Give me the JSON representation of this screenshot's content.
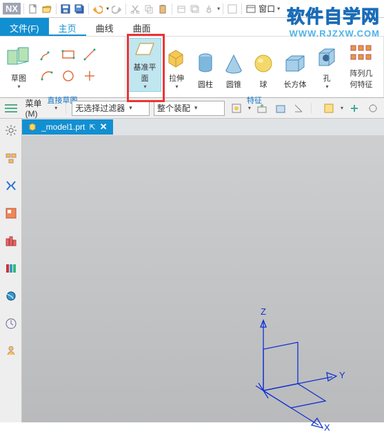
{
  "app": {
    "logo": "NX"
  },
  "qat": {
    "window_label": "窗口"
  },
  "tabs": {
    "file": "文件(F)",
    "home": "主页",
    "curve": "曲线",
    "surface": "曲面"
  },
  "ribbon": {
    "sketch_group_label": "直接草图",
    "sketch_big_label": "草图",
    "datum_plane": "基准平面",
    "extrude": "拉伸",
    "cylinder": "圆柱",
    "cone": "圆锥",
    "sphere": "球",
    "cuboid": "长方体",
    "hole": "孔",
    "pattern": "阵列几何特征",
    "feature_group_label": "特征"
  },
  "toolbar2": {
    "menu": "菜单(M)",
    "filter": "无选择过滤器",
    "assembly": "整个装配"
  },
  "doc": {
    "name": "_model1.prt",
    "pin": "⇱",
    "close": "✕"
  },
  "axes": {
    "x": "X",
    "y": "Y",
    "z": "Z"
  },
  "watermark": {
    "l1": "软件自学网",
    "l2": "WWW.RJZXW.COM"
  }
}
